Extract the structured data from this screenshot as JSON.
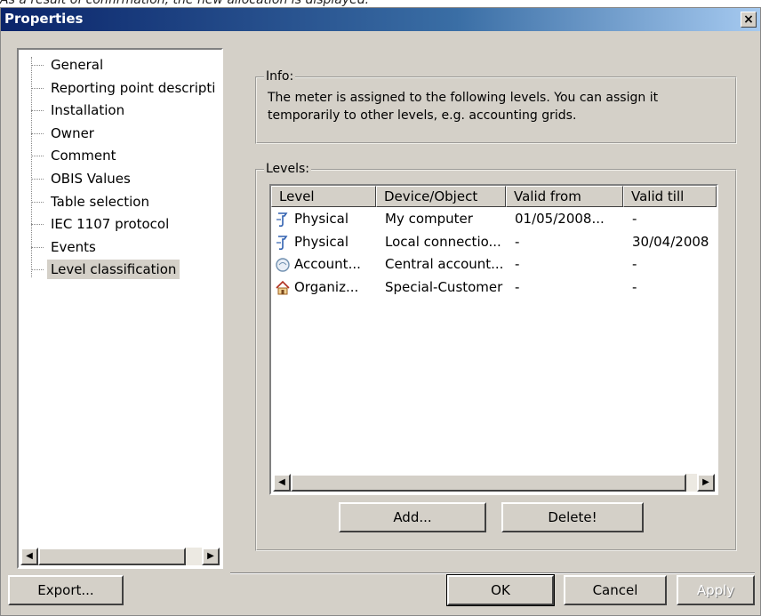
{
  "caption": "As a result of confirmation, the new allocation is displayed.",
  "window": {
    "title": "Properties",
    "close_label": "×"
  },
  "tree": {
    "items": [
      {
        "label": "General"
      },
      {
        "label": "Reporting point descripti"
      },
      {
        "label": "Installation"
      },
      {
        "label": "Owner"
      },
      {
        "label": "Comment"
      },
      {
        "label": "OBIS Values"
      },
      {
        "label": "Table selection"
      },
      {
        "label": "IEC 1107 protocol"
      },
      {
        "label": "Events"
      },
      {
        "label": "Level classification",
        "selected": true
      }
    ]
  },
  "info": {
    "legend": "Info:",
    "text": "The meter is assigned to the following levels. You can assign it temporarily to other levels, e.g. accounting grids."
  },
  "levels": {
    "legend": "Levels:",
    "columns": [
      "Level",
      "Device/Object",
      "Valid from",
      "Valid till"
    ],
    "rows": [
      {
        "icon": "physical-level-icon",
        "level": "Physical",
        "object": "My computer",
        "from": "01/05/2008...",
        "till": "-"
      },
      {
        "icon": "physical-level-icon",
        "level": "Physical",
        "object": "Local connectio...",
        "from": "-",
        "till": "30/04/2008"
      },
      {
        "icon": "accounting-level-icon",
        "level": "Account...",
        "object": "Central account...",
        "from": "-",
        "till": "-"
      },
      {
        "icon": "organization-level-icon",
        "level": "Organiz...",
        "object": "Special-Customer",
        "from": "-",
        "till": "-"
      }
    ],
    "add_label": "Add...",
    "delete_label": "Delete!"
  },
  "footer": {
    "export_label": "Export...",
    "ok_label": "OK",
    "cancel_label": "Cancel",
    "apply_label": "Apply"
  },
  "scroll_arrows": {
    "left": "◀",
    "right": "▶"
  }
}
